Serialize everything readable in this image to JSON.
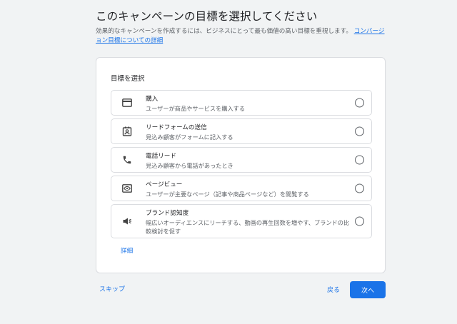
{
  "header": {
    "title": "このキャンペーンの目標を選択してください",
    "subtitle_text": "効果的なキャンペーンを作成するには、ビジネスにとって最も価値の高い目標を重視します。",
    "subtitle_link": "コンバージョン目標についての詳細"
  },
  "card": {
    "title": "目標を選択",
    "options": [
      {
        "icon": "credit-card-icon",
        "title": "購入",
        "description": "ユーザーが商品やサービスを購入する",
        "selected": false
      },
      {
        "icon": "contact-card-icon",
        "title": "リードフォームの送信",
        "description": "見込み顧客がフォームに記入する",
        "selected": false
      },
      {
        "icon": "phone-icon",
        "title": "電話リード",
        "description": "見込み顧客から電話があったとき",
        "selected": false
      },
      {
        "icon": "page-view-icon",
        "title": "ページビュー",
        "description": "ユーザーが主要なページ（記事や商品ページなど）を閲覧する",
        "selected": false
      },
      {
        "icon": "megaphone-icon",
        "title": "ブランド認知度",
        "description": "幅広いオーディエンスにリーチする、動画の再生回数を増やす、ブランドの比較検討を促す",
        "selected": false
      }
    ],
    "details_link": "詳細"
  },
  "footer": {
    "skip": "スキップ",
    "back": "戻る",
    "next": "次へ"
  },
  "colors": {
    "accent": "#1a73e8",
    "background": "#f1f3f4",
    "border": "#dadce0"
  }
}
